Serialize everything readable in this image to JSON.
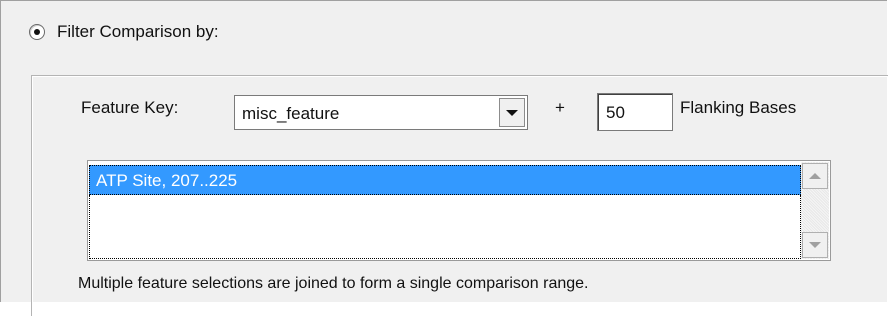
{
  "filter_option": {
    "label": "Filter Comparison by:",
    "selected": true
  },
  "feature_key": {
    "label": "Feature Key:",
    "selected_value": "misc_feature"
  },
  "plus_sign": "+",
  "flanking": {
    "value": "50",
    "label": "Flanking Bases"
  },
  "feature_list": {
    "items": [
      "ATP Site, 207..225"
    ],
    "selected_index": 0
  },
  "note": "Multiple feature selections are joined to form a single comparison range.",
  "colors": {
    "selection": "#3399ff",
    "panel": "#f0f0f0"
  },
  "icons": {
    "combo": "chevron-down-icon",
    "scroll_up": "scroll-up-arrow-icon",
    "scroll_down": "scroll-down-arrow-icon"
  }
}
